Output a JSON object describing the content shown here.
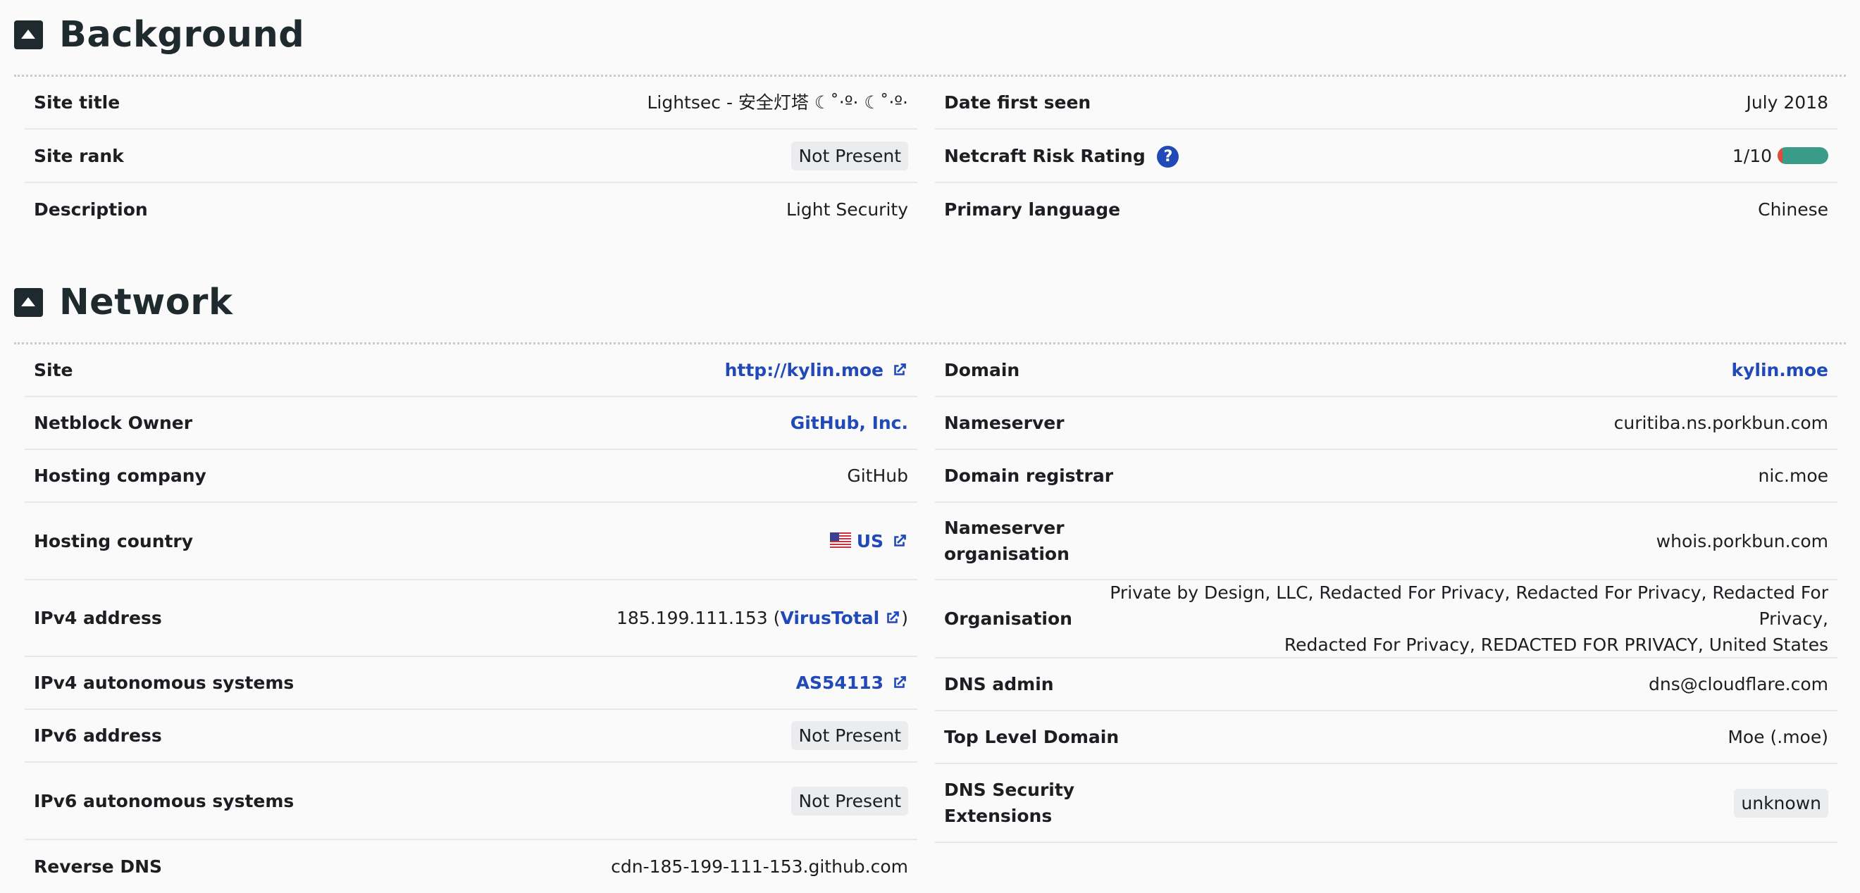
{
  "background": {
    "title": "Background",
    "left": [
      {
        "label": "Site title",
        "value": "Lightsec - 安全灯塔 ☾˚‧º· ☾˚‧º·"
      },
      {
        "label": "Site rank",
        "value": "Not Present"
      },
      {
        "label": "Description",
        "value": "Light Security"
      }
    ],
    "right": [
      {
        "label": "Date first seen",
        "value": "July 2018"
      },
      {
        "label": "Netcraft Risk Rating",
        "value": "1/10",
        "help": "?",
        "risk_fraction": 0.1
      },
      {
        "label": "Primary language",
        "value": "Chinese"
      }
    ]
  },
  "network": {
    "title": "Network",
    "left": [
      {
        "label": "Site",
        "value": "http://kylin.moe"
      },
      {
        "label": "Netblock Owner",
        "value": "GitHub, Inc."
      },
      {
        "label": "Hosting company",
        "value": "GitHub"
      },
      {
        "label": "Hosting country",
        "value": "US",
        "flag": "us-flag-icon"
      },
      {
        "label": "IPv4 address",
        "value": "185.199.111.153",
        "link": "VirusTotal",
        "open": "(",
        "close": ")"
      },
      {
        "label": "IPv4 autonomous systems",
        "value": "AS54113"
      },
      {
        "label": "IPv6 address",
        "value": "Not Present"
      },
      {
        "label": "IPv6 autonomous systems",
        "value": "Not Present"
      },
      {
        "label": "Reverse DNS",
        "value": "cdn-185-199-111-153.github.com"
      }
    ],
    "right": [
      {
        "label": "Domain",
        "value": "kylin.moe"
      },
      {
        "label": "Nameserver",
        "value": "curitiba.ns.porkbun.com"
      },
      {
        "label": "Domain registrar",
        "value": "nic.moe"
      },
      {
        "label_line1": "Nameserver",
        "label_line2": "organisation",
        "value": "whois.porkbun.com"
      },
      {
        "label": "Organisation",
        "value_line1": "Private by Design, LLC, Redacted For Privacy, Redacted For Privacy, Redacted For Privacy,",
        "value_line2": "Redacted For Privacy, REDACTED FOR PRIVACY, United States"
      },
      {
        "label": "DNS admin",
        "value": "dns@cloudflare.com"
      },
      {
        "label": "Top Level Domain",
        "value": "Moe (.moe)"
      },
      {
        "label_line1": "DNS Security",
        "label_line2": "Extensions",
        "value": "unknown"
      }
    ]
  },
  "colors": {
    "link": "#2149b8",
    "risk_low": "#3a9b88",
    "risk_high": "#e14b3b"
  }
}
